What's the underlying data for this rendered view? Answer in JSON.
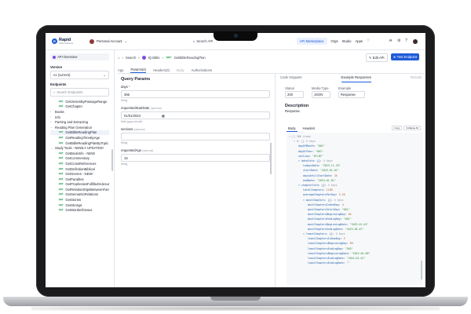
{
  "topbar": {
    "logo_text": "Rapid",
    "logo_sub": "Nokia Solutions",
    "account_label": "Personal Account",
    "search_label": "Search API",
    "nav": [
      "API Marketplace",
      "Orgs",
      "Studio",
      "Apps"
    ]
  },
  "sidebar": {
    "api_overview": "API Overview",
    "version_label": "Version",
    "version_value": "v1 (current)",
    "endpoints_label": "Endpoints",
    "search_placeholder": "Search Endpoints",
    "items": [
      {
        "label": "GetVersesByPassageRange",
        "kind": "get",
        "level": "sub"
      },
      {
        "label": "GetChapter",
        "kind": "get",
        "level": "sub"
      },
      {
        "label": "Books",
        "kind": "group"
      },
      {
        "label": "Info",
        "kind": "group"
      },
      {
        "label": "Parsing and Extracting",
        "kind": "group"
      },
      {
        "label": "Reading Plan Generation",
        "kind": "group-open"
      },
      {
        "label": "GetBibleReadingPlan",
        "kind": "get",
        "level": "sub"
      },
      {
        "label": "GetReadingTimeByAge",
        "kind": "get",
        "level": "sub"
      },
      {
        "label": "GetBibleReadingPlanByTopic",
        "kind": "get",
        "level": "sub"
      },
      {
        "label": "Study Tools - NEWLY UPDATED!",
        "kind": "group-open"
      },
      {
        "label": "GetBookInfo - NEW!",
        "kind": "get",
        "level": "sub"
      },
      {
        "label": "GetCommentary",
        "kind": "get",
        "level": "sub"
      },
      {
        "label": "GetCrossReferences",
        "kind": "get",
        "level": "sub"
      },
      {
        "label": "GetDefinitionBiblical",
        "kind": "get",
        "level": "sub"
      },
      {
        "label": "GetGenres - NEW!",
        "kind": "get",
        "level": "sub"
      },
      {
        "label": "GetParables",
        "kind": "get",
        "level": "sub"
      },
      {
        "label": "GetProphesiesFulfilledInJesus",
        "kind": "get",
        "level": "sub"
      },
      {
        "label": "GetRelationshipsBetweenFamiliesIde",
        "kind": "get",
        "level": "sub"
      },
      {
        "label": "GetSemanticRelations",
        "kind": "get",
        "level": "sub"
      },
      {
        "label": "GetStories",
        "kind": "get",
        "level": "sub"
      },
      {
        "label": "GetStrongs",
        "kind": "get",
        "level": "sub"
      },
      {
        "label": "GetWordsOfJesus",
        "kind": "get",
        "level": "sub"
      }
    ]
  },
  "crumbs": {
    "home": "⌂",
    "search": "Search",
    "api": "IQ Bible",
    "method": "GET",
    "endpoint": "GetBibleReadingPlan"
  },
  "actions": {
    "edit": "Edit API",
    "test": "Test Endpoint"
  },
  "tabs": [
    {
      "label": "App",
      "state": "normal"
    },
    {
      "label": "Params(4)",
      "state": "active"
    },
    {
      "label": "Headers(3)",
      "state": "normal"
    },
    {
      "label": "Body",
      "state": "dim"
    },
    {
      "label": "Authorizations",
      "state": "normal"
    }
  ],
  "params": {
    "title": "Query Params",
    "fields": [
      {
        "name": "days",
        "required": "*",
        "optional": "",
        "value": "365",
        "type": "String",
        "hint": ""
      },
      {
        "name": "requestedStartDate",
        "required": "",
        "optional": "(optional)",
        "value": "01/01/2023",
        "type": "",
        "hint": "Date (yyyy-mm-dd)"
      },
      {
        "name": "sections",
        "required": "",
        "optional": "(optional)",
        "value": "",
        "type": "String",
        "hint": ""
      },
      {
        "name": "requestedAge",
        "required": "",
        "optional": "(optional)",
        "value": "15",
        "type": "String",
        "hint": ""
      }
    ]
  },
  "right": {
    "tabs": [
      {
        "label": "Code Snippets",
        "state": "normal"
      },
      {
        "label": "Example Responses",
        "state": "active"
      },
      {
        "label": "Results",
        "state": "dim"
      }
    ],
    "status_label": "Status",
    "status_value": "200",
    "media_label": "Media Type",
    "media_value": "JSON",
    "example_label": "Example",
    "example_value": "Response",
    "description_title": "Description",
    "description_value": "Response",
    "body_tabs": [
      "Body",
      "Headers"
    ],
    "copy": "Copy",
    "collapse": "Collapse All"
  },
  "json_lines": [
    {
      "indent": 0,
      "text": "▾ [] 366 items",
      "cls": "jm"
    },
    {
      "indent": 1,
      "text": "▾ 0: {} 5 keys",
      "cls": "jm"
    },
    {
      "indent": 2,
      "key": "dayOfMonth",
      "val": "\"001\"",
      "cls": "js"
    },
    {
      "indent": 2,
      "key": "dayOfYear",
      "val": "\"001\"",
      "cls": "js"
    },
    {
      "indent": 2,
      "key": "section",
      "val": "\"OT+NT\"",
      "cls": "js"
    },
    {
      "indent": 2,
      "key": "▾ dateInfo: {}",
      "val": "4 keys",
      "cls": "jm"
    },
    {
      "indent": 3,
      "key": "todaysDate",
      "val": "\"2023-11-29\"",
      "cls": "js"
    },
    {
      "indent": 3,
      "key": "startDate",
      "val": "\"2023-01-01\"",
      "cls": "js"
    },
    {
      "indent": 3,
      "key": "daysUntilStartDate",
      "val": "35",
      "cls": "jn"
    },
    {
      "indent": 3,
      "key": "endDate",
      "val": "\"2024-01-01\"",
      "cls": "js"
    },
    {
      "indent": 2,
      "key": "▾ chapterInfo: {}",
      "val": "4 keys",
      "cls": "jm"
    },
    {
      "indent": 3,
      "key": "totalChapters",
      "val": "1189",
      "cls": "jn"
    },
    {
      "indent": 3,
      "key": "averageChaptersPerDay",
      "val": "3.26",
      "cls": "jn"
    },
    {
      "indent": 3,
      "key": "▾ mostChapters: {}",
      "val": "5 keys",
      "cls": "jm"
    },
    {
      "indent": 4,
      "key": "mostChaptersInOneDay",
      "val": "4",
      "cls": "jn"
    },
    {
      "indent": 4,
      "key": "mostChaptersStartDay",
      "val": "\"001\"",
      "cls": "js"
    },
    {
      "indent": 4,
      "key": "mostChaptersBeginningDay",
      "val": "04",
      "cls": "jn"
    },
    {
      "indent": 4,
      "key": "mostChaptersEndingDay",
      "val": "\"001\"",
      "cls": "js"
    },
    {
      "indent": 4,
      "key": "mostChaptersBeginningDate",
      "val": "\"2023-01-01\"",
      "cls": "js"
    },
    {
      "indent": 4,
      "key": "mostChaptersEndingDate",
      "val": "\"2023-04-07\"",
      "cls": "js"
    },
    {
      "indent": 3,
      "key": "▾ leastChapters: {}",
      "val": "5 keys",
      "cls": "jm"
    },
    {
      "indent": 4,
      "key": "leastChaptersInOneDay",
      "val": "3",
      "cls": "jn"
    },
    {
      "indent": 4,
      "key": "leastChaptersBeginningDay",
      "val": "99",
      "cls": "jn"
    },
    {
      "indent": 4,
      "key": "leastChaptersEndingDay",
      "val": "\"365\"",
      "cls": "js"
    },
    {
      "indent": 4,
      "key": "leastChaptersBeginningDate",
      "val": "\"2023-04-08\"",
      "cls": "js"
    },
    {
      "indent": 4,
      "key": "leastChaptersEndingDate",
      "val": "\"2024-01-01\"",
      "cls": "js"
    },
    {
      "indent": 4,
      "key": "leastChaptersEndingDate",
      "val": "\"\"",
      "cls": "js"
    }
  ]
}
